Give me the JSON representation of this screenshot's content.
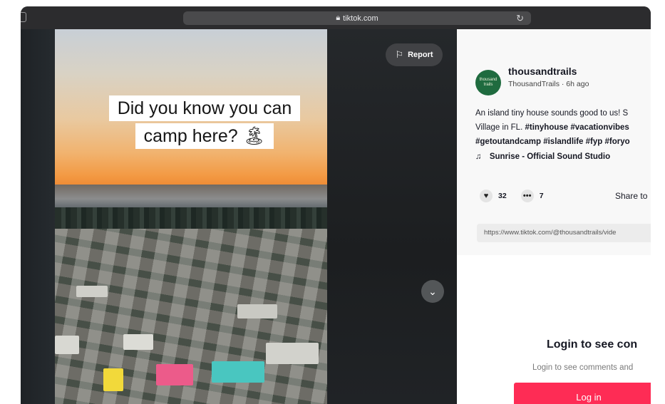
{
  "browser": {
    "url": "tiktok.com",
    "lock_icon": "lock-icon",
    "reload_icon": "reload-icon",
    "sidebar_icon": "sidebar-icon"
  },
  "video": {
    "caption_line1": "Did you know you can",
    "caption_line2": "camp here? 🏝",
    "report_label": "Report",
    "next_icon": "chevron-down-icon"
  },
  "post": {
    "avatar_text": "thousand trails",
    "username": "thousandtrails",
    "meta": "ThousandTrails · 6h ago",
    "description": {
      "line1": "An island tiny house sounds good to us! S",
      "line2_text": "Village in FL. ",
      "line2_tags": "#tinyhouse #vacationvibes",
      "line3_tags": "#getoutandcamp #islandlife #fyp #foryo"
    },
    "music": "Sunrise - Official Sound Studio",
    "likes": "32",
    "comments": "7",
    "share_label": "Share to",
    "link": "https://www.tiktok.com/@thousandtrails/vide"
  },
  "login": {
    "title": "Login to see con",
    "subtitle": "Login to see comments and",
    "button": "Log in"
  },
  "colors": {
    "accent": "#fe2c55",
    "avatar_bg": "#1f6b3f"
  }
}
